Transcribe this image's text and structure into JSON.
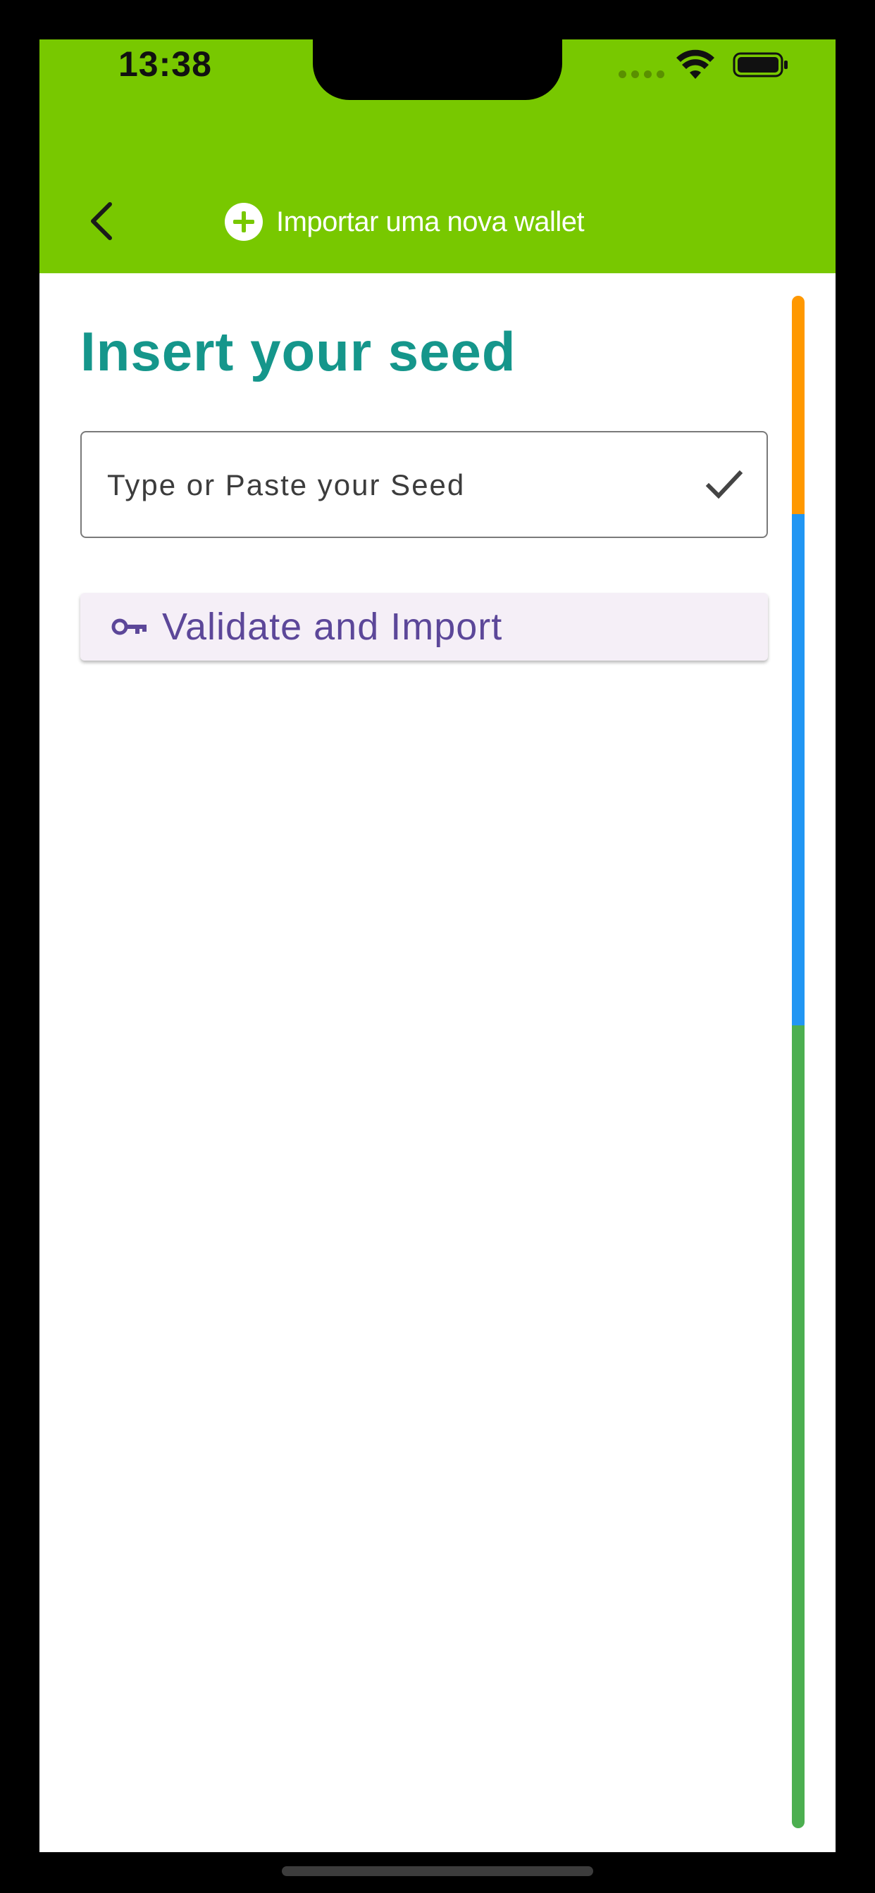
{
  "status_bar": {
    "time": "13:38"
  },
  "app_bar": {
    "title": "Importar uma nova wallet",
    "background_color": "#78c800",
    "back_icon": "chevron-left-icon",
    "title_icon": "plus-circle-icon"
  },
  "main": {
    "heading": "Insert your seed",
    "heading_color": "#15968b",
    "seed_input": {
      "placeholder": "Type or Paste your Seed",
      "value": "",
      "trailing_icon": "check-icon"
    },
    "import_button": {
      "label": "Validate and Import",
      "icon": "key-icon",
      "text_color": "#5c4799",
      "background_color": "#f5eff7"
    }
  },
  "progress_indicator": {
    "segments": [
      {
        "color": "#ff9800",
        "fraction": 0.1425
      },
      {
        "color": "#2196f3",
        "fraction": 0.3336
      },
      {
        "color": "#4caf50",
        "fraction": 0.5239
      }
    ]
  }
}
